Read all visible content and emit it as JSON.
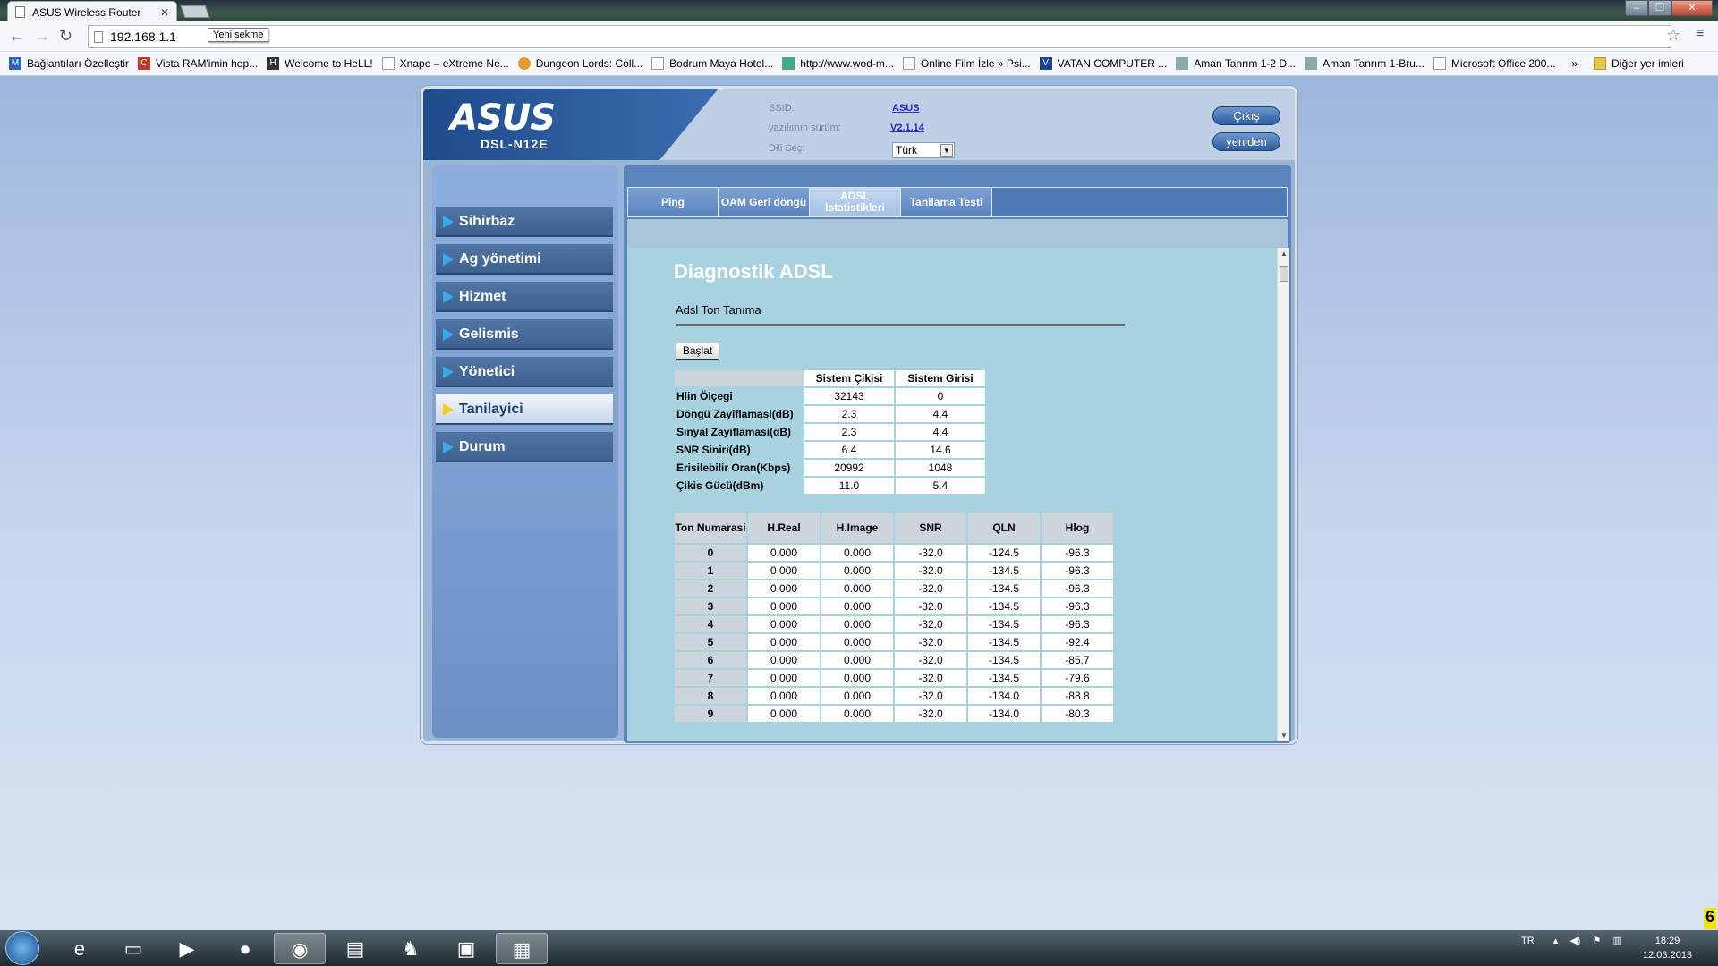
{
  "browser": {
    "tab_title": "ASUS Wireless Router",
    "url": "192.168.1.1",
    "new_tab_tooltip": "Yeni sekme",
    "bookmarks": [
      "Bağlantıları Özelleştir",
      "Vista RAM'imin hep...",
      "Welcome to HeLL!",
      "Xnape – eXtreme Ne...",
      "Dungeon Lords: Coll...",
      "Bodrum Maya Hotel...",
      "http://www.wod-m...",
      "Online Film İzle » Psi...",
      "VATAN COMPUTER ...",
      "Aman Tanrım 1-2 D...",
      "Aman Tanrım 1-Bru...",
      "Microsoft Office 200..."
    ],
    "bookmarks_more": "»",
    "other_bookmarks": "Diğer yer imleri"
  },
  "router": {
    "logo": "ASUS",
    "model": "DSL-N12E",
    "ssid_label": "SSID:",
    "ssid_value": "ASUS",
    "firmware_label": "yazılımın sürüm:",
    "firmware_value": "V2.1.14",
    "lang_label": "Dili Seç:",
    "lang_value": "Türk",
    "logout_button": "Çıkış",
    "restart_button": "yeniden"
  },
  "menu": [
    "Sihirbaz",
    "Ag yönetimi",
    "Hizmet",
    "Gelismis",
    "Yönetici",
    "Tanilayici",
    "Durum"
  ],
  "tabs": [
    "Ping",
    "OAM Geri döngü",
    "ADSL Istatistikleri",
    "Tanilama Testi"
  ],
  "page": {
    "title": "Diagnostik ADSL",
    "subtitle": "Adsl Ton Tanıma",
    "start_button": "Başlat"
  },
  "stats": {
    "headers": [
      "Sistem Çikisi",
      "Sistem Girisi"
    ],
    "rows": [
      {
        "label": "Hlin Ölçegi",
        "down": "32143",
        "up": "0"
      },
      {
        "label": "Döngü Zayiflamasi(dB)",
        "down": "2.3",
        "up": "4.4"
      },
      {
        "label": "Sinyal Zayiflamasi(dB)",
        "down": "2.3",
        "up": "4.4"
      },
      {
        "label": "SNR Siniri(dB)",
        "down": "6.4",
        "up": "14.6"
      },
      {
        "label": "Erisilebilir Oran(Kbps)",
        "down": "20992",
        "up": "1048"
      },
      {
        "label": "Çikis Gücü(dBm)",
        "down": "11.0",
        "up": "5.4"
      }
    ]
  },
  "tones": {
    "headers": [
      "Ton Numarasi",
      "H.Real",
      "H.Image",
      "SNR",
      "QLN",
      "Hlog"
    ],
    "rows": [
      [
        "0",
        "0.000",
        "0.000",
        "-32.0",
        "-124.5",
        "-96.3"
      ],
      [
        "1",
        "0.000",
        "0.000",
        "-32.0",
        "-134.5",
        "-96.3"
      ],
      [
        "2",
        "0.000",
        "0.000",
        "-32.0",
        "-134.5",
        "-96.3"
      ],
      [
        "3",
        "0.000",
        "0.000",
        "-32.0",
        "-134.5",
        "-96.3"
      ],
      [
        "4",
        "0.000",
        "0.000",
        "-32.0",
        "-134.5",
        "-96.3"
      ],
      [
        "5",
        "0.000",
        "0.000",
        "-32.0",
        "-134.5",
        "-92.4"
      ],
      [
        "6",
        "0.000",
        "0.000",
        "-32.0",
        "-134.5",
        "-85.7"
      ],
      [
        "7",
        "0.000",
        "0.000",
        "-32.0",
        "-134.5",
        "-79.6"
      ],
      [
        "8",
        "0.000",
        "0.000",
        "-32.0",
        "-134.0",
        "-88.8"
      ],
      [
        "9",
        "0.000",
        "0.000",
        "-32.0",
        "-134.0",
        "-80.3"
      ]
    ]
  },
  "taskbar": {
    "lang": "TR",
    "time": "18:29",
    "date": "12.03.2013",
    "corner_badge": "6"
  },
  "colors": {
    "sidebar_active_arrow": "#f2d11c",
    "sidebar_arrow": "#39a8f0",
    "panel_bg": "#a8d2e0",
    "link": "#2a2ad0"
  }
}
